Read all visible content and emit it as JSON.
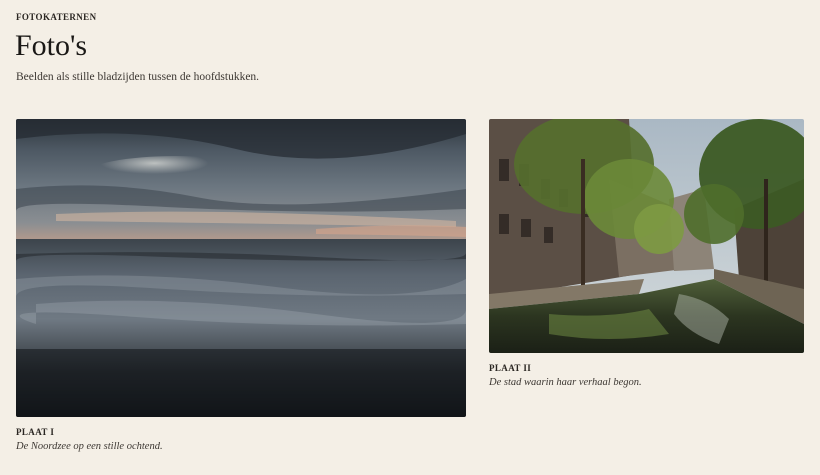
{
  "header": {
    "kicker": "FOTOKATERNEN",
    "title": "Foto's",
    "subtitle": "Beelden als stille bladzijden tussen de hoofdstukken."
  },
  "plates": [
    {
      "label": "PLAAT I",
      "caption": "De Noordzee op een stille ochtend."
    },
    {
      "label": "PLAAT II",
      "caption": "De stad waarin haar verhaal begon."
    }
  ]
}
